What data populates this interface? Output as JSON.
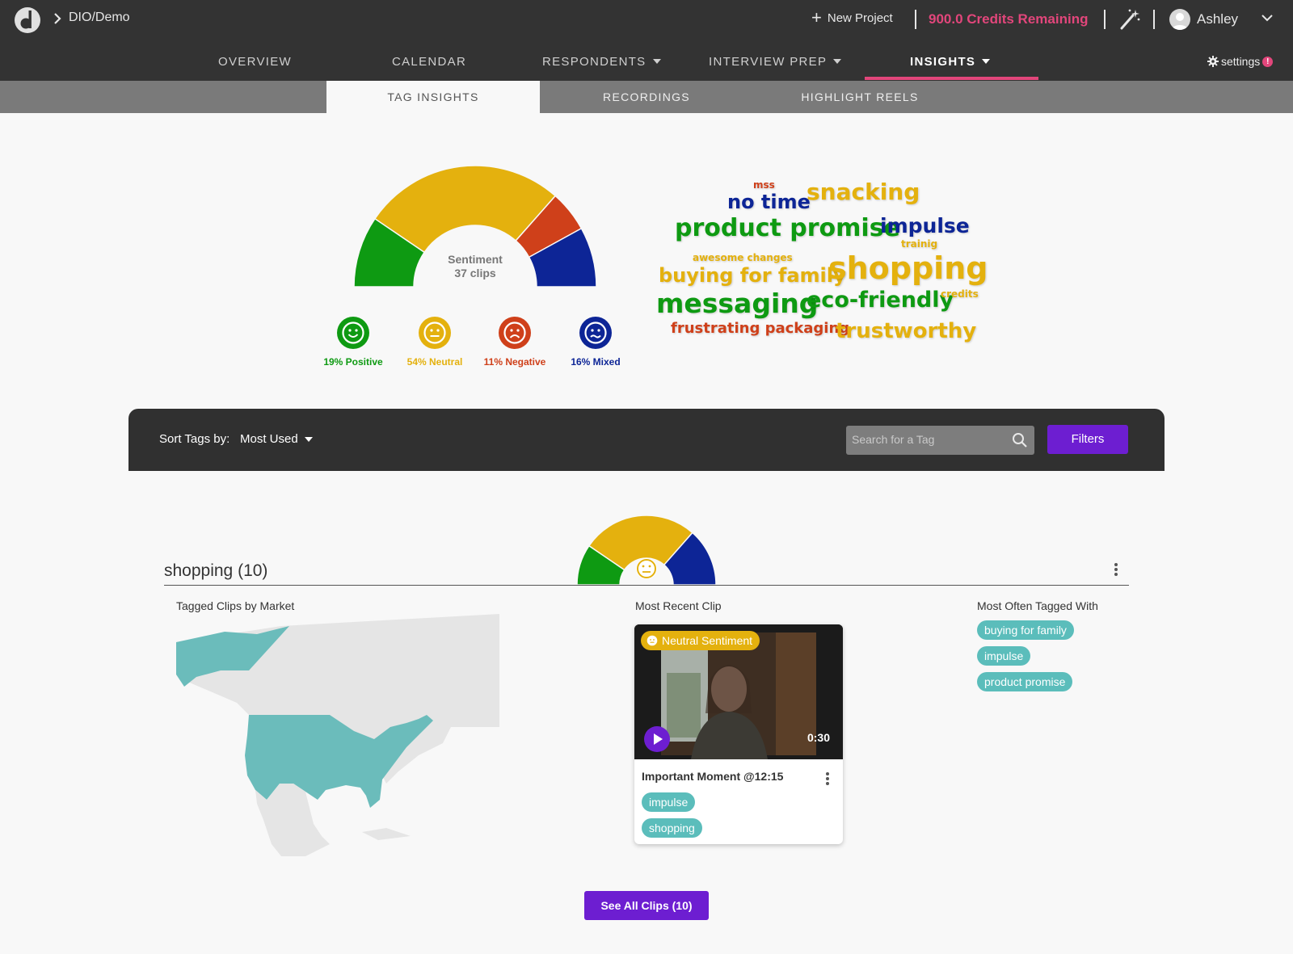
{
  "header": {
    "breadcrumb": "DIO/Demo",
    "new_project_label": "New Project",
    "credits": "900.0 Credits Remaining",
    "user_name": "Ashley",
    "settings_label": "settings",
    "settings_alert": "!"
  },
  "nav": {
    "items": [
      {
        "label": "OVERVIEW"
      },
      {
        "label": "CALENDAR"
      },
      {
        "label": "RESPONDENTS"
      },
      {
        "label": "INTERVIEW PREP"
      },
      {
        "label": "INSIGHTS"
      }
    ],
    "active": "INSIGHTS"
  },
  "subnav": {
    "tabs": [
      {
        "label": "TAG INSIGHTS"
      },
      {
        "label": "RECORDINGS"
      },
      {
        "label": "HIGHLIGHT REELS"
      }
    ],
    "active": "TAG INSIGHTS"
  },
  "sentiment": {
    "title": "Sentiment",
    "clips": "37 clips",
    "legend": [
      {
        "label": "19% Positive",
        "value": 19,
        "color": "#0e9a12"
      },
      {
        "label": "54% Neutral",
        "value": 54,
        "color": "#e4b10e"
      },
      {
        "label": "11% Negative",
        "value": 11,
        "color": "#cf401a"
      },
      {
        "label": "16% Mixed",
        "value": 16,
        "color": "#0d2596"
      }
    ]
  },
  "word_cloud": {
    "words": [
      {
        "text": "mss",
        "color": "#cf401a"
      },
      {
        "text": "no time",
        "color": "#0d2596"
      },
      {
        "text": "snacking",
        "color": "#e4b10e"
      },
      {
        "text": "product promise",
        "color": "#0e9a12"
      },
      {
        "text": "impulse",
        "color": "#0d2596"
      },
      {
        "text": "trainig",
        "color": "#e4b10e"
      },
      {
        "text": "awesome changes",
        "color": "#e4b10e"
      },
      {
        "text": "buying for family",
        "color": "#e4b10e"
      },
      {
        "text": "shopping",
        "color": "#e4b10e"
      },
      {
        "text": "messaging",
        "color": "#0e9a12"
      },
      {
        "text": "eco-friendly",
        "color": "#0e9a12"
      },
      {
        "text": "credits",
        "color": "#e4b10e"
      },
      {
        "text": "frustrating packaging",
        "color": "#cf401a"
      },
      {
        "text": "trustworthy",
        "color": "#e4b10e"
      }
    ]
  },
  "toolbar": {
    "sort_label": "Sort Tags by:",
    "sort_value": "Most Used",
    "search_placeholder": "Search for a Tag",
    "filters_label": "Filters"
  },
  "tag": {
    "title": "shopping (10)",
    "sentiment": [
      {
        "name": "Positive",
        "value": 19
      },
      {
        "name": "Neutral",
        "value": 54
      },
      {
        "name": "Mixed",
        "value": 27
      }
    ],
    "map_label": "Tagged Clips by Market",
    "recent_label": "Most Recent Clip",
    "related_label": "Most Often Tagged With",
    "related_tags": [
      "buying for family",
      "impulse",
      "product promise"
    ],
    "clip": {
      "badge": "Neutral Sentiment",
      "duration": "0:30",
      "title": "Important Moment @12:15",
      "tags": [
        "impulse",
        "shopping"
      ]
    },
    "see_all_label": "See All Clips (10)"
  },
  "colors": {
    "accent": "#e2467b",
    "purple": "#6d1ed1",
    "teal": "#5bbdbb",
    "topbar": "#333333"
  }
}
